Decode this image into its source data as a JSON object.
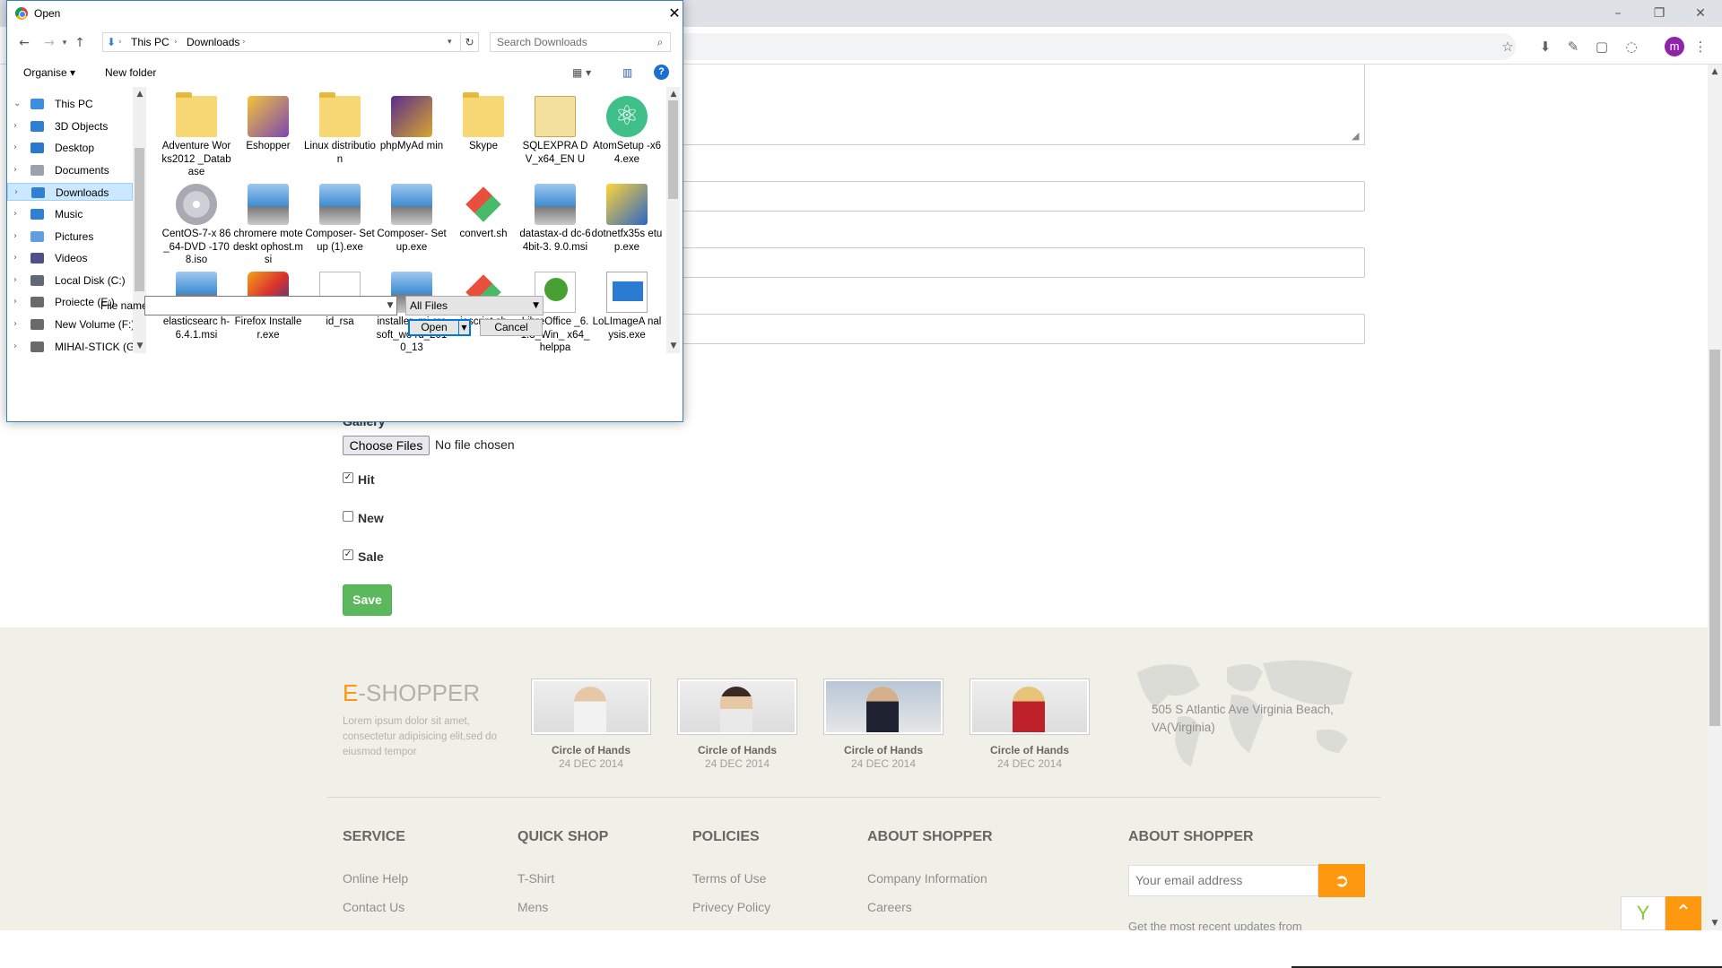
{
  "browser": {
    "window_controls": {
      "minimize": "–",
      "restore": "❐",
      "close": "✕"
    },
    "profile_initial": "m"
  },
  "page": {
    "gallery_label": "Gallery",
    "choose_files_label": "Choose Files",
    "no_file_text": "No file chosen",
    "checkboxes": [
      {
        "label": "Hit",
        "checked": true
      },
      {
        "label": "New",
        "checked": false
      },
      {
        "label": "Sale",
        "checked": true
      }
    ],
    "save_label": "Save"
  },
  "footer": {
    "logo_e": "E",
    "logo_rest": "-SHOPPER",
    "description": "Lorem ipsum dolor sit amet, consectetur adipisicing elit,sed do eiusmod tempor",
    "videos": [
      {
        "title": "Circle of Hands",
        "date": "24 DEC 2014"
      },
      {
        "title": "Circle of Hands",
        "date": "24 DEC 2014"
      },
      {
        "title": "Circle of Hands",
        "date": "24 DEC 2014"
      },
      {
        "title": "Circle of Hands",
        "date": "24 DEC 2014"
      }
    ],
    "address": "505 S Atlantic Ave Virginia Beach, VA(Virginia)",
    "columns": [
      {
        "heading": "SERVICE",
        "links": [
          "Online Help",
          "Contact Us"
        ]
      },
      {
        "heading": "QUICK SHOP",
        "links": [
          "T-Shirt",
          "Mens"
        ]
      },
      {
        "heading": "POLICIES",
        "links": [
          "Terms of Use",
          "Privecy Policy"
        ]
      },
      {
        "heading": "ABOUT SHOPPER",
        "links": [
          "Company Information",
          "Careers"
        ]
      }
    ],
    "subscribe_heading": "ABOUT SHOPPER",
    "email_placeholder": "Your email address",
    "subscribe_note": "Get the most recent updates from"
  },
  "dialog": {
    "title": "Open",
    "close": "✕",
    "breadcrumb": [
      "This PC",
      "Downloads"
    ],
    "search_placeholder": "Search Downloads",
    "organise_label": "Organise ▾",
    "new_folder_label": "New folder",
    "help_label": "?",
    "nav_tree": [
      {
        "label": "This PC",
        "color": "#3b8de0",
        "expanded": true
      },
      {
        "label": "3D Objects",
        "color": "#2f7fd3"
      },
      {
        "label": "Desktop",
        "color": "#2b79cf"
      },
      {
        "label": "Documents",
        "color": "#9aa3ad"
      },
      {
        "label": "Downloads",
        "color": "#2f7fd3",
        "selected": true
      },
      {
        "label": "Music",
        "color": "#2f7fd3"
      },
      {
        "label": "Pictures",
        "color": "#5f9fde"
      },
      {
        "label": "Videos",
        "color": "#4f4f8a"
      },
      {
        "label": "Local Disk (C:)",
        "color": "#5f6a75"
      },
      {
        "label": "Proiecte (E:)",
        "color": "#6a6a6a"
      },
      {
        "label": "New Volume (F:)",
        "color": "#6a6a6a"
      },
      {
        "label": "MIHAI-STICK (G",
        "color": "#6a6a6a"
      }
    ],
    "files": [
      {
        "name": "Adventure Works2012 _Database",
        "icon": "folder"
      },
      {
        "name": "Eshopper",
        "icon": "eshop"
      },
      {
        "name": "Linux distribution",
        "icon": "folder"
      },
      {
        "name": "phpMyAd min",
        "icon": "php"
      },
      {
        "name": "Skype",
        "icon": "folder"
      },
      {
        "name": "SQLEXPRA DV_x64_EN U",
        "icon": "sql"
      },
      {
        "name": "AtomSetup -x64.exe",
        "icon": "atom"
      },
      {
        "name": "CentOS-7-x 86_64-DVD -1708.iso",
        "icon": "disc"
      },
      {
        "name": "chromere motedeskt ophost.msi",
        "icon": "setup"
      },
      {
        "name": "Composer- Setup (1).exe",
        "icon": "setup"
      },
      {
        "name": "Composer- Setup.exe",
        "icon": "setup"
      },
      {
        "name": "convert.sh",
        "icon": "git"
      },
      {
        "name": "datastax-d dc-64bit-3. 9.0.msi",
        "icon": "setup"
      },
      {
        "name": "dotnetfx35s etup.exe",
        "icon": "net"
      },
      {
        "name": "elasticsearc h-6.4.1.msi",
        "icon": "setup"
      },
      {
        "name": "Firefox Installer.exe",
        "icon": "firefox"
      },
      {
        "name": "id_rsa",
        "icon": "blank"
      },
      {
        "name": "installer_mi crosoft_wo rd_2010_13",
        "icon": "setup"
      },
      {
        "name": "ioscript.sh",
        "icon": "git"
      },
      {
        "name": "LibreOffice _6.1.3_Win_ x64_helppa",
        "icon": "torrent"
      },
      {
        "name": "LoLImageA nalysis.exe",
        "icon": "lol"
      }
    ],
    "filename_label": "File name:",
    "filename_value": "",
    "filetype_value": "All Files",
    "open_label": "Open",
    "cancel_label": "Cancel"
  },
  "colors": {
    "accent_orange": "#fe980f",
    "save_green": "#5cb85c",
    "footer_bg": "#f0f0e9",
    "dialog_border": "#3d7fc1",
    "selection_blue": "#cce8ff"
  }
}
